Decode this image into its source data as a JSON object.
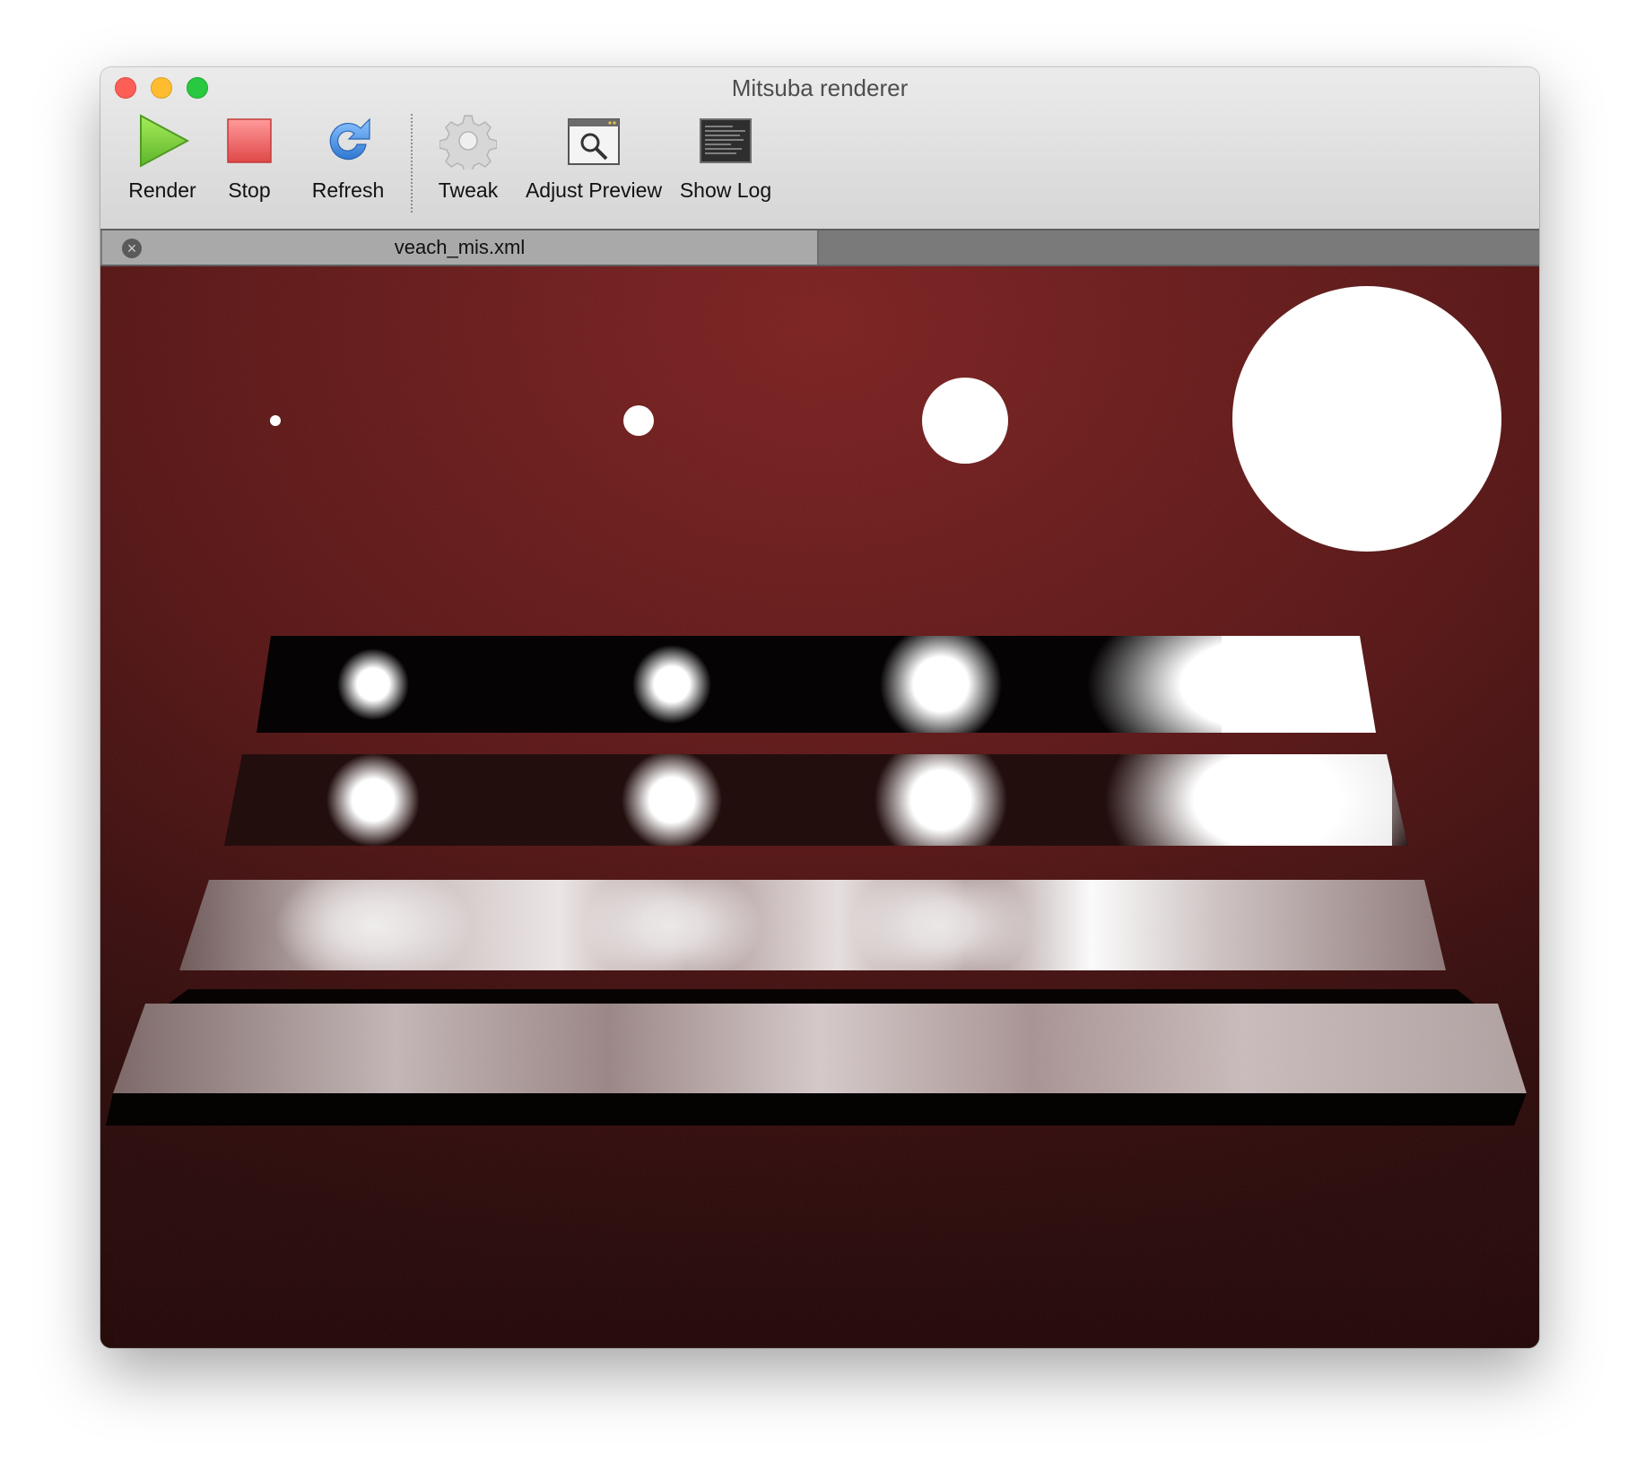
{
  "window": {
    "title": "Mitsuba renderer"
  },
  "toolbar": {
    "render_label": "Render",
    "stop_label": "Stop",
    "refresh_label": "Refresh",
    "tweak_label": "Tweak",
    "adjust_preview_label": "Adjust Preview",
    "show_log_label": "Show Log"
  },
  "tabs": [
    {
      "label": "veach_mis.xml"
    }
  ],
  "colors": {
    "render_icon": "#7fd23f",
    "stop_icon": "#ef5b5b",
    "refresh_icon": "#3f8ee0",
    "scene_background": "#6a1a1a"
  }
}
